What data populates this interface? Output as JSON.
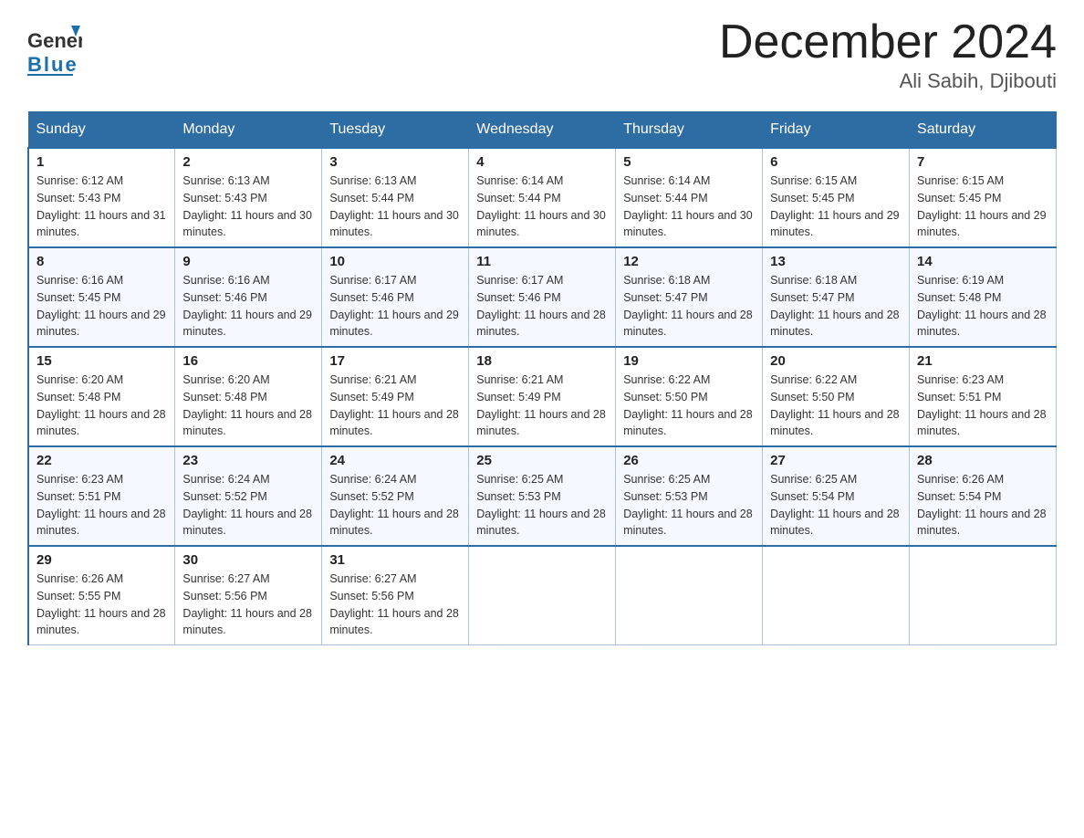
{
  "header": {
    "logo_general": "General",
    "logo_blue": "Blue",
    "month_title": "December 2024",
    "location": "Ali Sabih, Djibouti"
  },
  "days_of_week": [
    "Sunday",
    "Monday",
    "Tuesday",
    "Wednesday",
    "Thursday",
    "Friday",
    "Saturday"
  ],
  "weeks": [
    [
      {
        "day": "1",
        "sunrise": "6:12 AM",
        "sunset": "5:43 PM",
        "daylight": "11 hours and 31 minutes."
      },
      {
        "day": "2",
        "sunrise": "6:13 AM",
        "sunset": "5:43 PM",
        "daylight": "11 hours and 30 minutes."
      },
      {
        "day": "3",
        "sunrise": "6:13 AM",
        "sunset": "5:44 PM",
        "daylight": "11 hours and 30 minutes."
      },
      {
        "day": "4",
        "sunrise": "6:14 AM",
        "sunset": "5:44 PM",
        "daylight": "11 hours and 30 minutes."
      },
      {
        "day": "5",
        "sunrise": "6:14 AM",
        "sunset": "5:44 PM",
        "daylight": "11 hours and 30 minutes."
      },
      {
        "day": "6",
        "sunrise": "6:15 AM",
        "sunset": "5:45 PM",
        "daylight": "11 hours and 29 minutes."
      },
      {
        "day": "7",
        "sunrise": "6:15 AM",
        "sunset": "5:45 PM",
        "daylight": "11 hours and 29 minutes."
      }
    ],
    [
      {
        "day": "8",
        "sunrise": "6:16 AM",
        "sunset": "5:45 PM",
        "daylight": "11 hours and 29 minutes."
      },
      {
        "day": "9",
        "sunrise": "6:16 AM",
        "sunset": "5:46 PM",
        "daylight": "11 hours and 29 minutes."
      },
      {
        "day": "10",
        "sunrise": "6:17 AM",
        "sunset": "5:46 PM",
        "daylight": "11 hours and 29 minutes."
      },
      {
        "day": "11",
        "sunrise": "6:17 AM",
        "sunset": "5:46 PM",
        "daylight": "11 hours and 28 minutes."
      },
      {
        "day": "12",
        "sunrise": "6:18 AM",
        "sunset": "5:47 PM",
        "daylight": "11 hours and 28 minutes."
      },
      {
        "day": "13",
        "sunrise": "6:18 AM",
        "sunset": "5:47 PM",
        "daylight": "11 hours and 28 minutes."
      },
      {
        "day": "14",
        "sunrise": "6:19 AM",
        "sunset": "5:48 PM",
        "daylight": "11 hours and 28 minutes."
      }
    ],
    [
      {
        "day": "15",
        "sunrise": "6:20 AM",
        "sunset": "5:48 PM",
        "daylight": "11 hours and 28 minutes."
      },
      {
        "day": "16",
        "sunrise": "6:20 AM",
        "sunset": "5:48 PM",
        "daylight": "11 hours and 28 minutes."
      },
      {
        "day": "17",
        "sunrise": "6:21 AM",
        "sunset": "5:49 PM",
        "daylight": "11 hours and 28 minutes."
      },
      {
        "day": "18",
        "sunrise": "6:21 AM",
        "sunset": "5:49 PM",
        "daylight": "11 hours and 28 minutes."
      },
      {
        "day": "19",
        "sunrise": "6:22 AM",
        "sunset": "5:50 PM",
        "daylight": "11 hours and 28 minutes."
      },
      {
        "day": "20",
        "sunrise": "6:22 AM",
        "sunset": "5:50 PM",
        "daylight": "11 hours and 28 minutes."
      },
      {
        "day": "21",
        "sunrise": "6:23 AM",
        "sunset": "5:51 PM",
        "daylight": "11 hours and 28 minutes."
      }
    ],
    [
      {
        "day": "22",
        "sunrise": "6:23 AM",
        "sunset": "5:51 PM",
        "daylight": "11 hours and 28 minutes."
      },
      {
        "day": "23",
        "sunrise": "6:24 AM",
        "sunset": "5:52 PM",
        "daylight": "11 hours and 28 minutes."
      },
      {
        "day": "24",
        "sunrise": "6:24 AM",
        "sunset": "5:52 PM",
        "daylight": "11 hours and 28 minutes."
      },
      {
        "day": "25",
        "sunrise": "6:25 AM",
        "sunset": "5:53 PM",
        "daylight": "11 hours and 28 minutes."
      },
      {
        "day": "26",
        "sunrise": "6:25 AM",
        "sunset": "5:53 PM",
        "daylight": "11 hours and 28 minutes."
      },
      {
        "day": "27",
        "sunrise": "6:25 AM",
        "sunset": "5:54 PM",
        "daylight": "11 hours and 28 minutes."
      },
      {
        "day": "28",
        "sunrise": "6:26 AM",
        "sunset": "5:54 PM",
        "daylight": "11 hours and 28 minutes."
      }
    ],
    [
      {
        "day": "29",
        "sunrise": "6:26 AM",
        "sunset": "5:55 PM",
        "daylight": "11 hours and 28 minutes."
      },
      {
        "day": "30",
        "sunrise": "6:27 AM",
        "sunset": "5:56 PM",
        "daylight": "11 hours and 28 minutes."
      },
      {
        "day": "31",
        "sunrise": "6:27 AM",
        "sunset": "5:56 PM",
        "daylight": "11 hours and 28 minutes."
      },
      null,
      null,
      null,
      null
    ]
  ],
  "labels": {
    "sunrise": "Sunrise:",
    "sunset": "Sunset:",
    "daylight": "Daylight:"
  }
}
